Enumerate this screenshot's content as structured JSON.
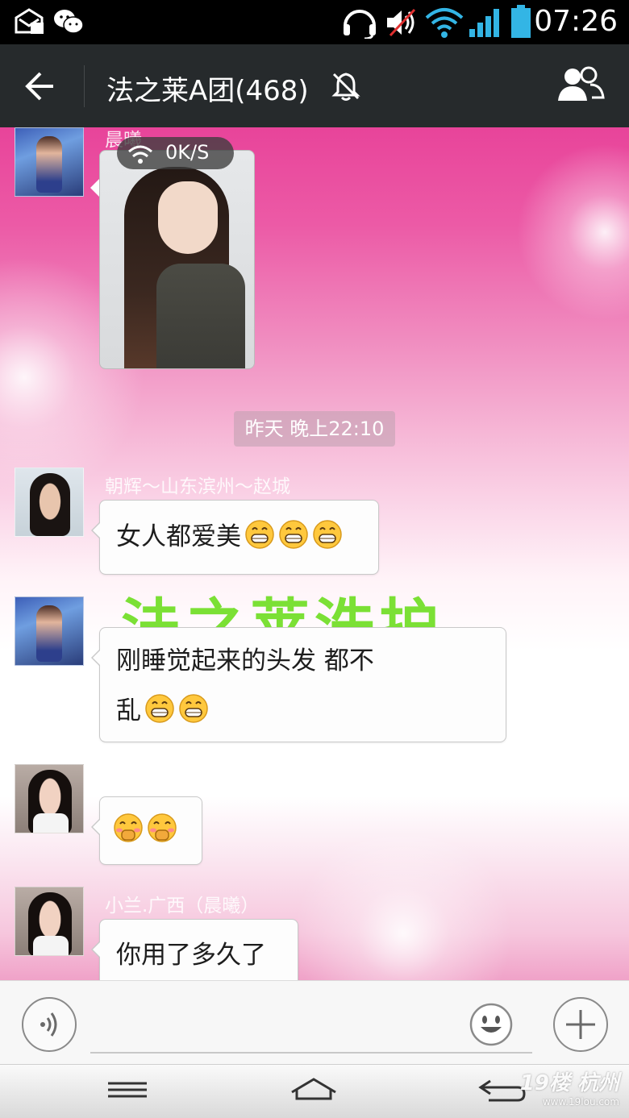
{
  "status_bar": {
    "time": "07:26",
    "icons": [
      "sms-sync-icon",
      "wechat-icon",
      "headset-icon",
      "volume-muted-icon",
      "wifi-icon",
      "signal-icon",
      "battery-icon"
    ]
  },
  "header": {
    "title": "法之莱A团(468)",
    "muted": true
  },
  "messages": [
    {
      "sender": "晨曦",
      "type": "image",
      "network_speed": "0K/S"
    },
    {
      "sender": "朝辉～山东滨州～赵城",
      "type": "text",
      "text": "女人都爱美",
      "emojis": [
        "grin",
        "grin",
        "grin"
      ]
    },
    {
      "sender": "",
      "type": "text",
      "text_line1": "刚睡觉起来的头发 都不",
      "text_line2": "乱",
      "emojis": [
        "grin",
        "grin"
      ]
    },
    {
      "sender": "",
      "type": "emoji",
      "emojis": [
        "giggle",
        "giggle"
      ]
    },
    {
      "sender": "小兰.广西（晨曦）",
      "type": "text",
      "text": "你用了多久了"
    }
  ],
  "timestamp": "昨天 晚上22:10",
  "background_banner": "法之莱洗护",
  "input": {
    "placeholder": "",
    "value": ""
  },
  "watermark": {
    "brand": "19楼 杭州",
    "url": "www.19lou.com"
  },
  "colors": {
    "action_bar": "#262a2c",
    "bubble_bg": "#fdfdfd",
    "accent_pink": "#e8449a",
    "banner_green": "#7be035"
  }
}
